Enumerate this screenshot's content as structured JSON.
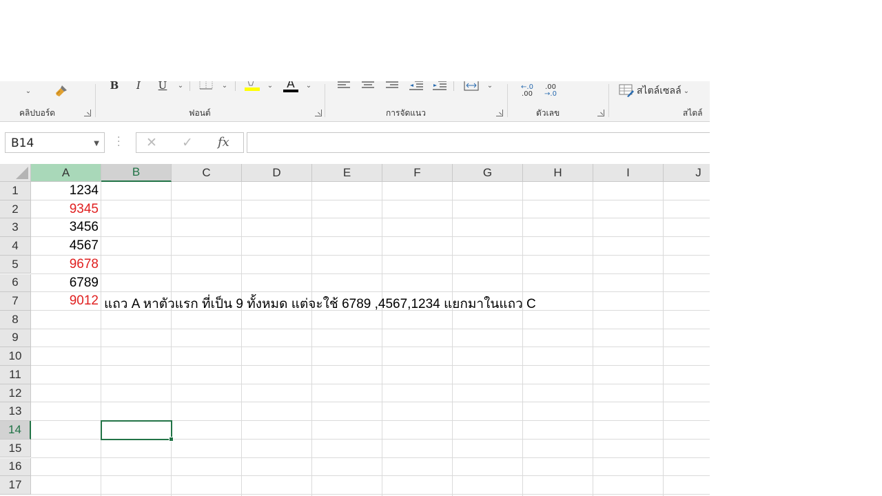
{
  "ribbon": {
    "clipboard_label": "คลิปบอร์ด",
    "font_label": "ฟอนต์",
    "alignment_label": "การจัดแนว",
    "number_label": "ตัวเลข",
    "styles_label": "สไตล์",
    "cell_styles_button": "สไตล์เซลล์",
    "bold": "B",
    "italic": "I",
    "underline": "U",
    "font_color_letter": "A",
    "inc_decimal_top": "←.0",
    "inc_decimal_bottom": ".00",
    "dec_decimal_top": ".00",
    "dec_decimal_bottom": "→.0",
    "highlight_color": "#ffff00",
    "font_color": "#000000"
  },
  "formula_bar": {
    "name_box": "B14",
    "cancel": "✕",
    "enter": "✓",
    "fx": "fx",
    "value": ""
  },
  "columns": [
    "A",
    "B",
    "C",
    "D",
    "E",
    "F",
    "G",
    "H",
    "I",
    "J"
  ],
  "rows": [
    "1",
    "2",
    "3",
    "4",
    "5",
    "6",
    "7",
    "8",
    "9",
    "10",
    "11",
    "12",
    "13",
    "14",
    "15",
    "16",
    "17"
  ],
  "selected_cell": "B14",
  "cells": {
    "A1": "1234",
    "A2": "9345",
    "A3": "3456",
    "A4": "4567",
    "A5": "9678",
    "A6": "6789",
    "A7": "9012",
    "B7": "แถว A หาตัวแรก ที่เป็น 9 ทั้งหมด แต่จะใช้ 6789 ,4567,1234 แยกมาในแถว C"
  },
  "colors": {
    "accent": "#217346",
    "red_text": "#e02020"
  }
}
